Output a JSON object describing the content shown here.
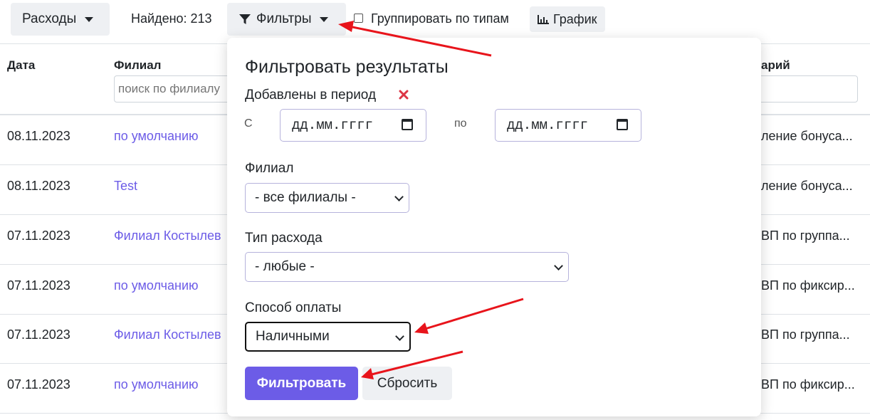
{
  "topbar": {
    "expenses_label": "Расходы",
    "found_label": "Найдено: 213",
    "filters_label": "Фильтры",
    "group_label": "Группировать по типам",
    "chart_label": "График"
  },
  "table": {
    "headers": {
      "date": "Дата",
      "branch": "Филиал",
      "comment": "арий"
    },
    "branch_search_placeholder": "поиск по филиалу",
    "rows": [
      {
        "date": "08.11.2023",
        "branch": "по умолчанию",
        "comment": "ление бонуса..."
      },
      {
        "date": "08.11.2023",
        "branch": "Test",
        "comment": "ление бонуса..."
      },
      {
        "date": "07.11.2023",
        "branch": "Филиал Костылев",
        "comment": "ВП по группа..."
      },
      {
        "date": "07.11.2023",
        "branch": "по умолчанию",
        "comment": "ВП по фиксир..."
      },
      {
        "date": "07.11.2023",
        "branch": "Филиал Костылев",
        "comment": "ВП по группа..."
      },
      {
        "date": "07.11.2023",
        "branch": "по умолчанию",
        "comment": "ВП по фиксир..."
      }
    ]
  },
  "filter_popup": {
    "title": "Фильтровать результаты",
    "period_label": "Добавлены в период",
    "from_label": "С",
    "to_label": "по",
    "from_placeholder": "дд.мм.гггг",
    "to_placeholder": "дд.мм.гггг",
    "branch_label": "Филиал",
    "branch_value": "- все филиалы -",
    "type_label": "Тип расхода",
    "type_value": "- любые -",
    "payment_label": "Способ оплаты",
    "payment_value": "Наличными",
    "apply_label": "Фильтровать",
    "reset_label": "Сбросить"
  },
  "colors": {
    "accent": "#6c5ce7",
    "link": "#6c5ce7",
    "clear_icon": "#dc3545",
    "annotation_arrow": "#e8141b"
  }
}
